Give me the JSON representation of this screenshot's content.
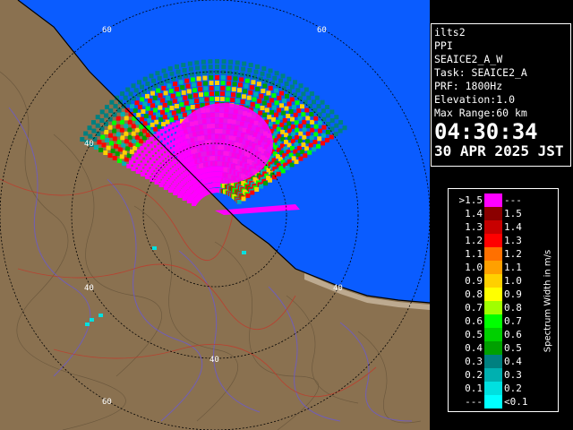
{
  "info": {
    "station": "ilts2",
    "product": "PPI",
    "scan_name": "SEAICE2_A_W",
    "task": "Task: SEAICE2_A",
    "prf": "PRF: 1800Hz",
    "elevation": "Elevation:1.0",
    "max_range": "Max Range:60 km",
    "time": "04:30:34",
    "date": "30 APR 2025 JST"
  },
  "map": {
    "range_labels": [
      "60",
      "60",
      "40",
      "40",
      "40",
      "40",
      "60"
    ],
    "colors": {
      "sea": "#0a5cff",
      "land": "#8a7150",
      "range_ring": "#000000",
      "echo_main": "#ff00ff"
    }
  },
  "legend": {
    "title": "Spectrum Width in m/s",
    "rows": [
      {
        "left": ">1.5",
        "right": "---",
        "color": "#ff00ff"
      },
      {
        "left": "1.4",
        "right": "1.5",
        "color": "#8b0000"
      },
      {
        "left": "1.3",
        "right": "1.4",
        "color": "#c80000"
      },
      {
        "left": "1.2",
        "right": "1.3",
        "color": "#ff0000"
      },
      {
        "left": "1.1",
        "right": "1.2",
        "color": "#ff7000"
      },
      {
        "left": "1.0",
        "right": "1.1",
        "color": "#ffa000"
      },
      {
        "left": "0.9",
        "right": "1.0",
        "color": "#ffd000"
      },
      {
        "left": "0.8",
        "right": "0.9",
        "color": "#ffff00"
      },
      {
        "left": "0.7",
        "right": "0.8",
        "color": "#a0ff00"
      },
      {
        "left": "0.6",
        "right": "0.7",
        "color": "#00ff00"
      },
      {
        "left": "0.5",
        "right": "0.6",
        "color": "#00d000"
      },
      {
        "left": "0.4",
        "right": "0.5",
        "color": "#00a000"
      },
      {
        "left": "0.3",
        "right": "0.4",
        "color": "#008080"
      },
      {
        "left": "0.2",
        "right": "0.3",
        "color": "#00b0b0"
      },
      {
        "left": "0.1",
        "right": "0.2",
        "color": "#00e0e0"
      },
      {
        "left": "---",
        "right": "<0.1",
        "color": "#00ffff"
      }
    ]
  }
}
